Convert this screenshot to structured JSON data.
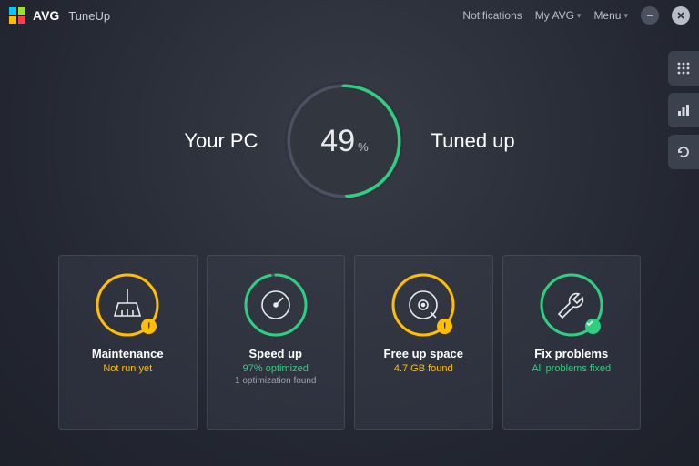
{
  "brand": {
    "name": "AVG",
    "product": "TuneUp"
  },
  "header": {
    "notifications": "Notifications",
    "myavg": "My AVG",
    "menu": "Menu"
  },
  "gauge": {
    "left": "Your PC",
    "right": "Tuned up",
    "value": "49",
    "unit": "%",
    "percent": 49
  },
  "cards": [
    {
      "title": "Maintenance",
      "sub1": "Not run yet",
      "sub2": "",
      "sub1Class": "or",
      "ring": "orange",
      "progress": 100,
      "icon": "broom",
      "badge": "warn"
    },
    {
      "title": "Speed up",
      "sub1": "97% optimized",
      "sub2": "1 optimization found",
      "sub1Class": "gr",
      "ring": "green",
      "progress": 97,
      "icon": "gauge",
      "badge": ""
    },
    {
      "title": "Free up space",
      "sub1": "4.7 GB found",
      "sub2": "",
      "sub1Class": "or",
      "ring": "orange",
      "progress": 100,
      "icon": "disk",
      "badge": "warn"
    },
    {
      "title": "Fix problems",
      "sub1": "All problems fixed",
      "sub2": "",
      "sub1Class": "gr",
      "ring": "green",
      "progress": 100,
      "icon": "wrench",
      "badge": "ok"
    }
  ]
}
